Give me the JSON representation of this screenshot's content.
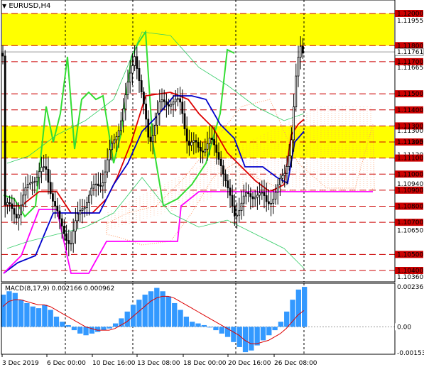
{
  "window": {
    "symbol_label": "EURUSD,H4",
    "menu_icon": "triangle-down-icon"
  },
  "colors": {
    "zone_fill": "#ffff00",
    "level_line": "#cc0000",
    "candles": "#000000",
    "green_line": "#33dd33",
    "red_line": "#dd0000",
    "blue_line": "#0000cc",
    "magenta_line": "#ff00ff",
    "cloud": "#ff9966",
    "envelope": "#33cc66",
    "macd_hist": "#3399ff",
    "macd_signal": "#dd0000",
    "current_price_label_bg": "#ffffff"
  },
  "price_axis": {
    "labels": [
      {
        "text": "1.12000",
        "price": 1.12,
        "style": "level"
      },
      {
        "text": "1.11955",
        "price": 1.11955,
        "style": "plain"
      },
      {
        "text": "1.11800",
        "price": 1.118,
        "style": "level"
      },
      {
        "text": "1.11761",
        "price": 1.11761,
        "style": "current"
      },
      {
        "text": "1.11700",
        "price": 1.117,
        "style": "level"
      },
      {
        "text": "1.11665",
        "price": 1.11665,
        "style": "plain"
      },
      {
        "text": "1.11500",
        "price": 1.115,
        "style": "level"
      },
      {
        "text": "1.11400",
        "price": 1.114,
        "style": "level"
      },
      {
        "text": "1.11300",
        "price": 1.113,
        "style": "level"
      },
      {
        "text": "1.11120",
        "price": 1.1112,
        "style": "plain"
      },
      {
        "text": "1.11200",
        "price": 1.112,
        "style": "level"
      },
      {
        "text": "1.11100",
        "price": 1.111,
        "style": "level"
      },
      {
        "text": "1.11000",
        "price": 1.11,
        "style": "level"
      },
      {
        "text": "1.10940",
        "price": 1.1094,
        "style": "plain"
      },
      {
        "text": "1.10900",
        "price": 1.109,
        "style": "level"
      },
      {
        "text": "1.10800",
        "price": 1.108,
        "style": "level"
      },
      {
        "text": "1.10700",
        "price": 1.107,
        "style": "level"
      },
      {
        "text": "1.10650",
        "price": 1.1065,
        "style": "plain"
      },
      {
        "text": "1.10500",
        "price": 1.105,
        "style": "level"
      },
      {
        "text": "1.10400",
        "price": 1.104,
        "style": "level"
      },
      {
        "text": "1.10360",
        "price": 1.1036,
        "style": "plain"
      }
    ],
    "extra_labels": [
      "1.11395",
      "1.11300"
    ],
    "levels": [
      1.12,
      1.118,
      1.117,
      1.115,
      1.114,
      1.113,
      1.112,
      1.111,
      1.11,
      1.109,
      1.108,
      1.107,
      1.105,
      1.104
    ],
    "zones": [
      [
        1.118,
        1.12
      ],
      [
        1.111,
        1.113
      ]
    ]
  },
  "time_axis": {
    "labels": [
      "3 Dec 2019",
      "6 Dec 00:00",
      "10 Dec 16:00",
      "13 Dec 08:00",
      "18 Dec 00:00",
      "20 Dec 16:00",
      "26 Dec 08:00"
    ]
  },
  "macd": {
    "label": "MACD(8,17,9) 0.002166 0.000962",
    "axis_labels": [
      "0.002363",
      "0.00",
      "-0.001538"
    ],
    "histogram": [
      0.0019,
      0.0021,
      0.002,
      0.0016,
      0.0014,
      0.0012,
      0.0011,
      0.0013,
      0.001,
      0.0006,
      0.0003,
      0.0001,
      -0.0002,
      -0.0004,
      -0.0005,
      -0.0004,
      -0.0003,
      -0.0002,
      -0.0001,
      0.0002,
      0.0005,
      0.0009,
      0.0013,
      0.0016,
      0.0019,
      0.0021,
      0.0023,
      0.0021,
      0.0018,
      0.0014,
      0.001,
      0.0006,
      0.0003,
      0.0002,
      0.0001,
      0.0,
      -0.0002,
      -0.0004,
      -0.0006,
      -0.0009,
      -0.0012,
      -0.0015,
      -0.0014,
      -0.0011,
      -0.0008,
      -0.0005,
      -0.0002,
      0.0003,
      0.0009,
      0.0016,
      0.0022,
      0.00236
    ],
    "signal": [
      0.0012,
      0.0015,
      0.0016,
      0.0016,
      0.0015,
      0.0014,
      0.0013,
      0.0013,
      0.0012,
      0.001,
      0.0008,
      0.0006,
      0.0004,
      0.0002,
      0.0,
      -0.0001,
      -0.0002,
      -0.0002,
      -0.0002,
      -0.0001,
      0.0001,
      0.0003,
      0.0006,
      0.0009,
      0.0012,
      0.0015,
      0.0017,
      0.0018,
      0.0018,
      0.0017,
      0.0015,
      0.0013,
      0.0011,
      0.0009,
      0.0007,
      0.0005,
      0.0003,
      0.0001,
      -0.0001,
      -0.0003,
      -0.0005,
      -0.0008,
      -0.001,
      -0.001,
      -0.0009,
      -0.0008,
      -0.0006,
      -0.0004,
      -0.0001,
      0.0003,
      0.0007,
      0.000962
    ]
  }
}
